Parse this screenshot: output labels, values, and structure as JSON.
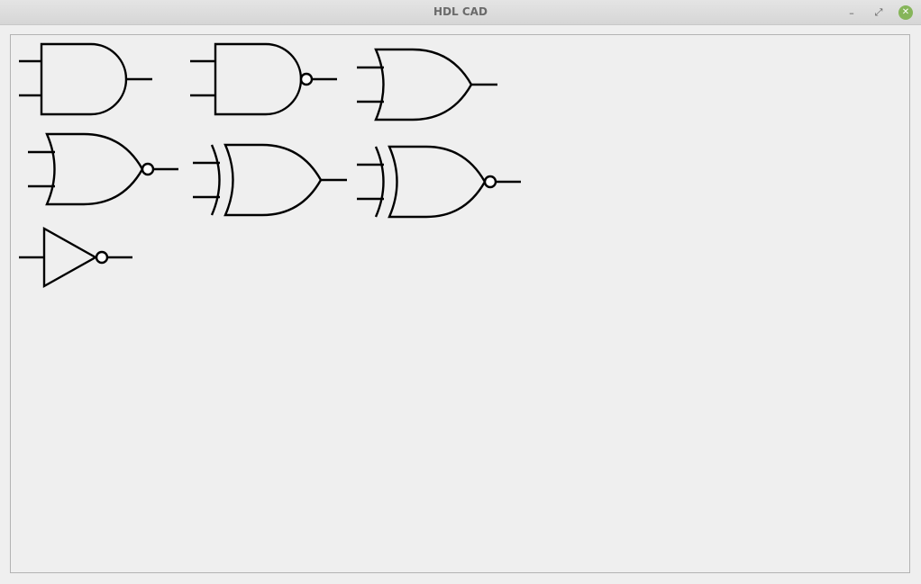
{
  "window": {
    "title": "HDL CAD",
    "controls": {
      "minimize": "–",
      "maximize": "⤢",
      "close": "✕"
    }
  },
  "canvas": {
    "gates": [
      {
        "type": "AND"
      },
      {
        "type": "NAND"
      },
      {
        "type": "OR"
      },
      {
        "type": "NOR"
      },
      {
        "type": "XOR"
      },
      {
        "type": "XNOR"
      },
      {
        "type": "NOT"
      }
    ]
  },
  "colors": {
    "close_button": "#86b55a",
    "stroke": "#000000",
    "background": "#efefef"
  }
}
